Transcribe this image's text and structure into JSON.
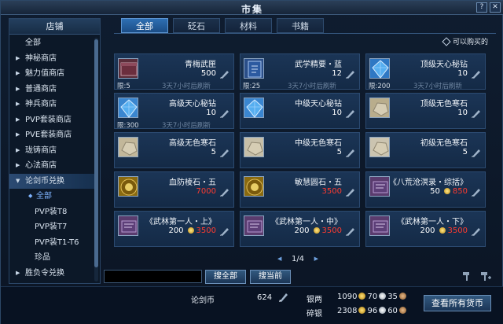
{
  "window": {
    "title": "市集"
  },
  "sidebar": {
    "title": "店铺",
    "items": [
      {
        "label": "全部",
        "arrow": false
      },
      {
        "label": "神秘商店",
        "arrow": true
      },
      {
        "label": "魅力值商店",
        "arrow": true
      },
      {
        "label": "普通商店",
        "arrow": true
      },
      {
        "label": "神兵商店",
        "arrow": true
      },
      {
        "label": "PVP套装商店",
        "arrow": true
      },
      {
        "label": "PVE套装商店",
        "arrow": true
      },
      {
        "label": "珑铸商店",
        "arrow": true
      },
      {
        "label": "心法商店",
        "arrow": true
      },
      {
        "label": "论剑币兑换",
        "arrow": true,
        "expanded": true
      },
      {
        "label": "全部",
        "sub": true,
        "selected": true
      },
      {
        "label": "PVP装T8",
        "sub": true
      },
      {
        "label": "PVP装T7",
        "sub": true
      },
      {
        "label": "PVP装T1-T6",
        "sub": true
      },
      {
        "label": "珍品",
        "sub": true
      },
      {
        "label": "胜负令兑换",
        "arrow": true
      }
    ]
  },
  "tabs": [
    {
      "label": "全部",
      "active": true
    },
    {
      "label": "砭石",
      "active": false
    },
    {
      "label": "材料",
      "active": false
    },
    {
      "label": "书籍",
      "active": false
    }
  ],
  "filter": {
    "label": "可以购买的"
  },
  "items": [
    {
      "name": "青梅武匣",
      "price": "500",
      "limit": "限:5",
      "refresh": "3天7小时后刷新",
      "icon": "box-icon",
      "color": "#5a2d3a"
    },
    {
      "name": "武学精要・蓝",
      "price": "12",
      "limit": "限:25",
      "refresh": "3天7小时后刷新",
      "icon": "book-icon",
      "color": "#2a4e88"
    },
    {
      "name": "顶级天心秘钻",
      "price": "10",
      "limit": "限:200",
      "refresh": "3天7小时后刷新",
      "icon": "diamond-icon",
      "color": "#2f78c4"
    },
    {
      "name": "高级天心秘钻",
      "price": "10",
      "limit": "限:300",
      "refresh": "3天7小时后刷新",
      "icon": "diamond-icon",
      "color": "#3a86d0"
    },
    {
      "name": "中级天心秘钻",
      "price": "10",
      "limit": "",
      "refresh": "",
      "icon": "diamond-icon",
      "color": "#3a86d0"
    },
    {
      "name": "顶级无色寒石",
      "price": "10",
      "limit": "",
      "refresh": "",
      "icon": "stone-icon",
      "color": "#b9ad8c"
    },
    {
      "name": "高级无色寒石",
      "price": "5",
      "limit": "",
      "refresh": "",
      "icon": "stone-icon",
      "color": "#c2b79a"
    },
    {
      "name": "中级无色寒石",
      "price": "5",
      "limit": "",
      "refresh": "",
      "icon": "stone-icon",
      "color": "#c7bfa8"
    },
    {
      "name": "初级无色寒石",
      "price": "5",
      "limit": "",
      "refresh": "",
      "icon": "stone-icon",
      "color": "#cbc4b0"
    },
    {
      "name": "血防棱石・五",
      "price": "7000",
      "red": true,
      "icon": "gem-icon",
      "color": "#8a6a10"
    },
    {
      "name": "敏慧圆石・五",
      "price": "3500",
      "red": true,
      "icon": "gem-icon",
      "color": "#8a6a10"
    },
    {
      "name": "《八荒沧溟录・综括》",
      "price": "850",
      "old": "50",
      "red": true,
      "icon": "scroll-icon",
      "color": "#5a3c6e"
    },
    {
      "name": "《武林第一人・上》",
      "price": "3500",
      "old": "200",
      "red": true,
      "icon": "scroll-icon",
      "color": "#5a3c6e"
    },
    {
      "name": "《武林第一人・中》",
      "price": "3500",
      "old": "200",
      "red": true,
      "icon": "scroll-icon",
      "color": "#5a3c6e"
    },
    {
      "name": "《武林第一人・下》",
      "price": "3500",
      "old": "200",
      "red": true,
      "icon": "scroll-icon",
      "color": "#5a3c6e"
    }
  ],
  "pager": {
    "text": "1/4"
  },
  "search": {
    "placeholder": "",
    "all_label": "搜全部",
    "current_label": "搜当前"
  },
  "currency": {
    "token_label": "论剑币",
    "token_value": "624",
    "silver_label": "银两",
    "silver_g": "1090",
    "silver_s": "70",
    "silver_c": "35",
    "broken_label": "碎银",
    "broken_g": "2308",
    "broken_s": "96",
    "broken_c": "60",
    "view_all_label": "查看所有货币"
  }
}
